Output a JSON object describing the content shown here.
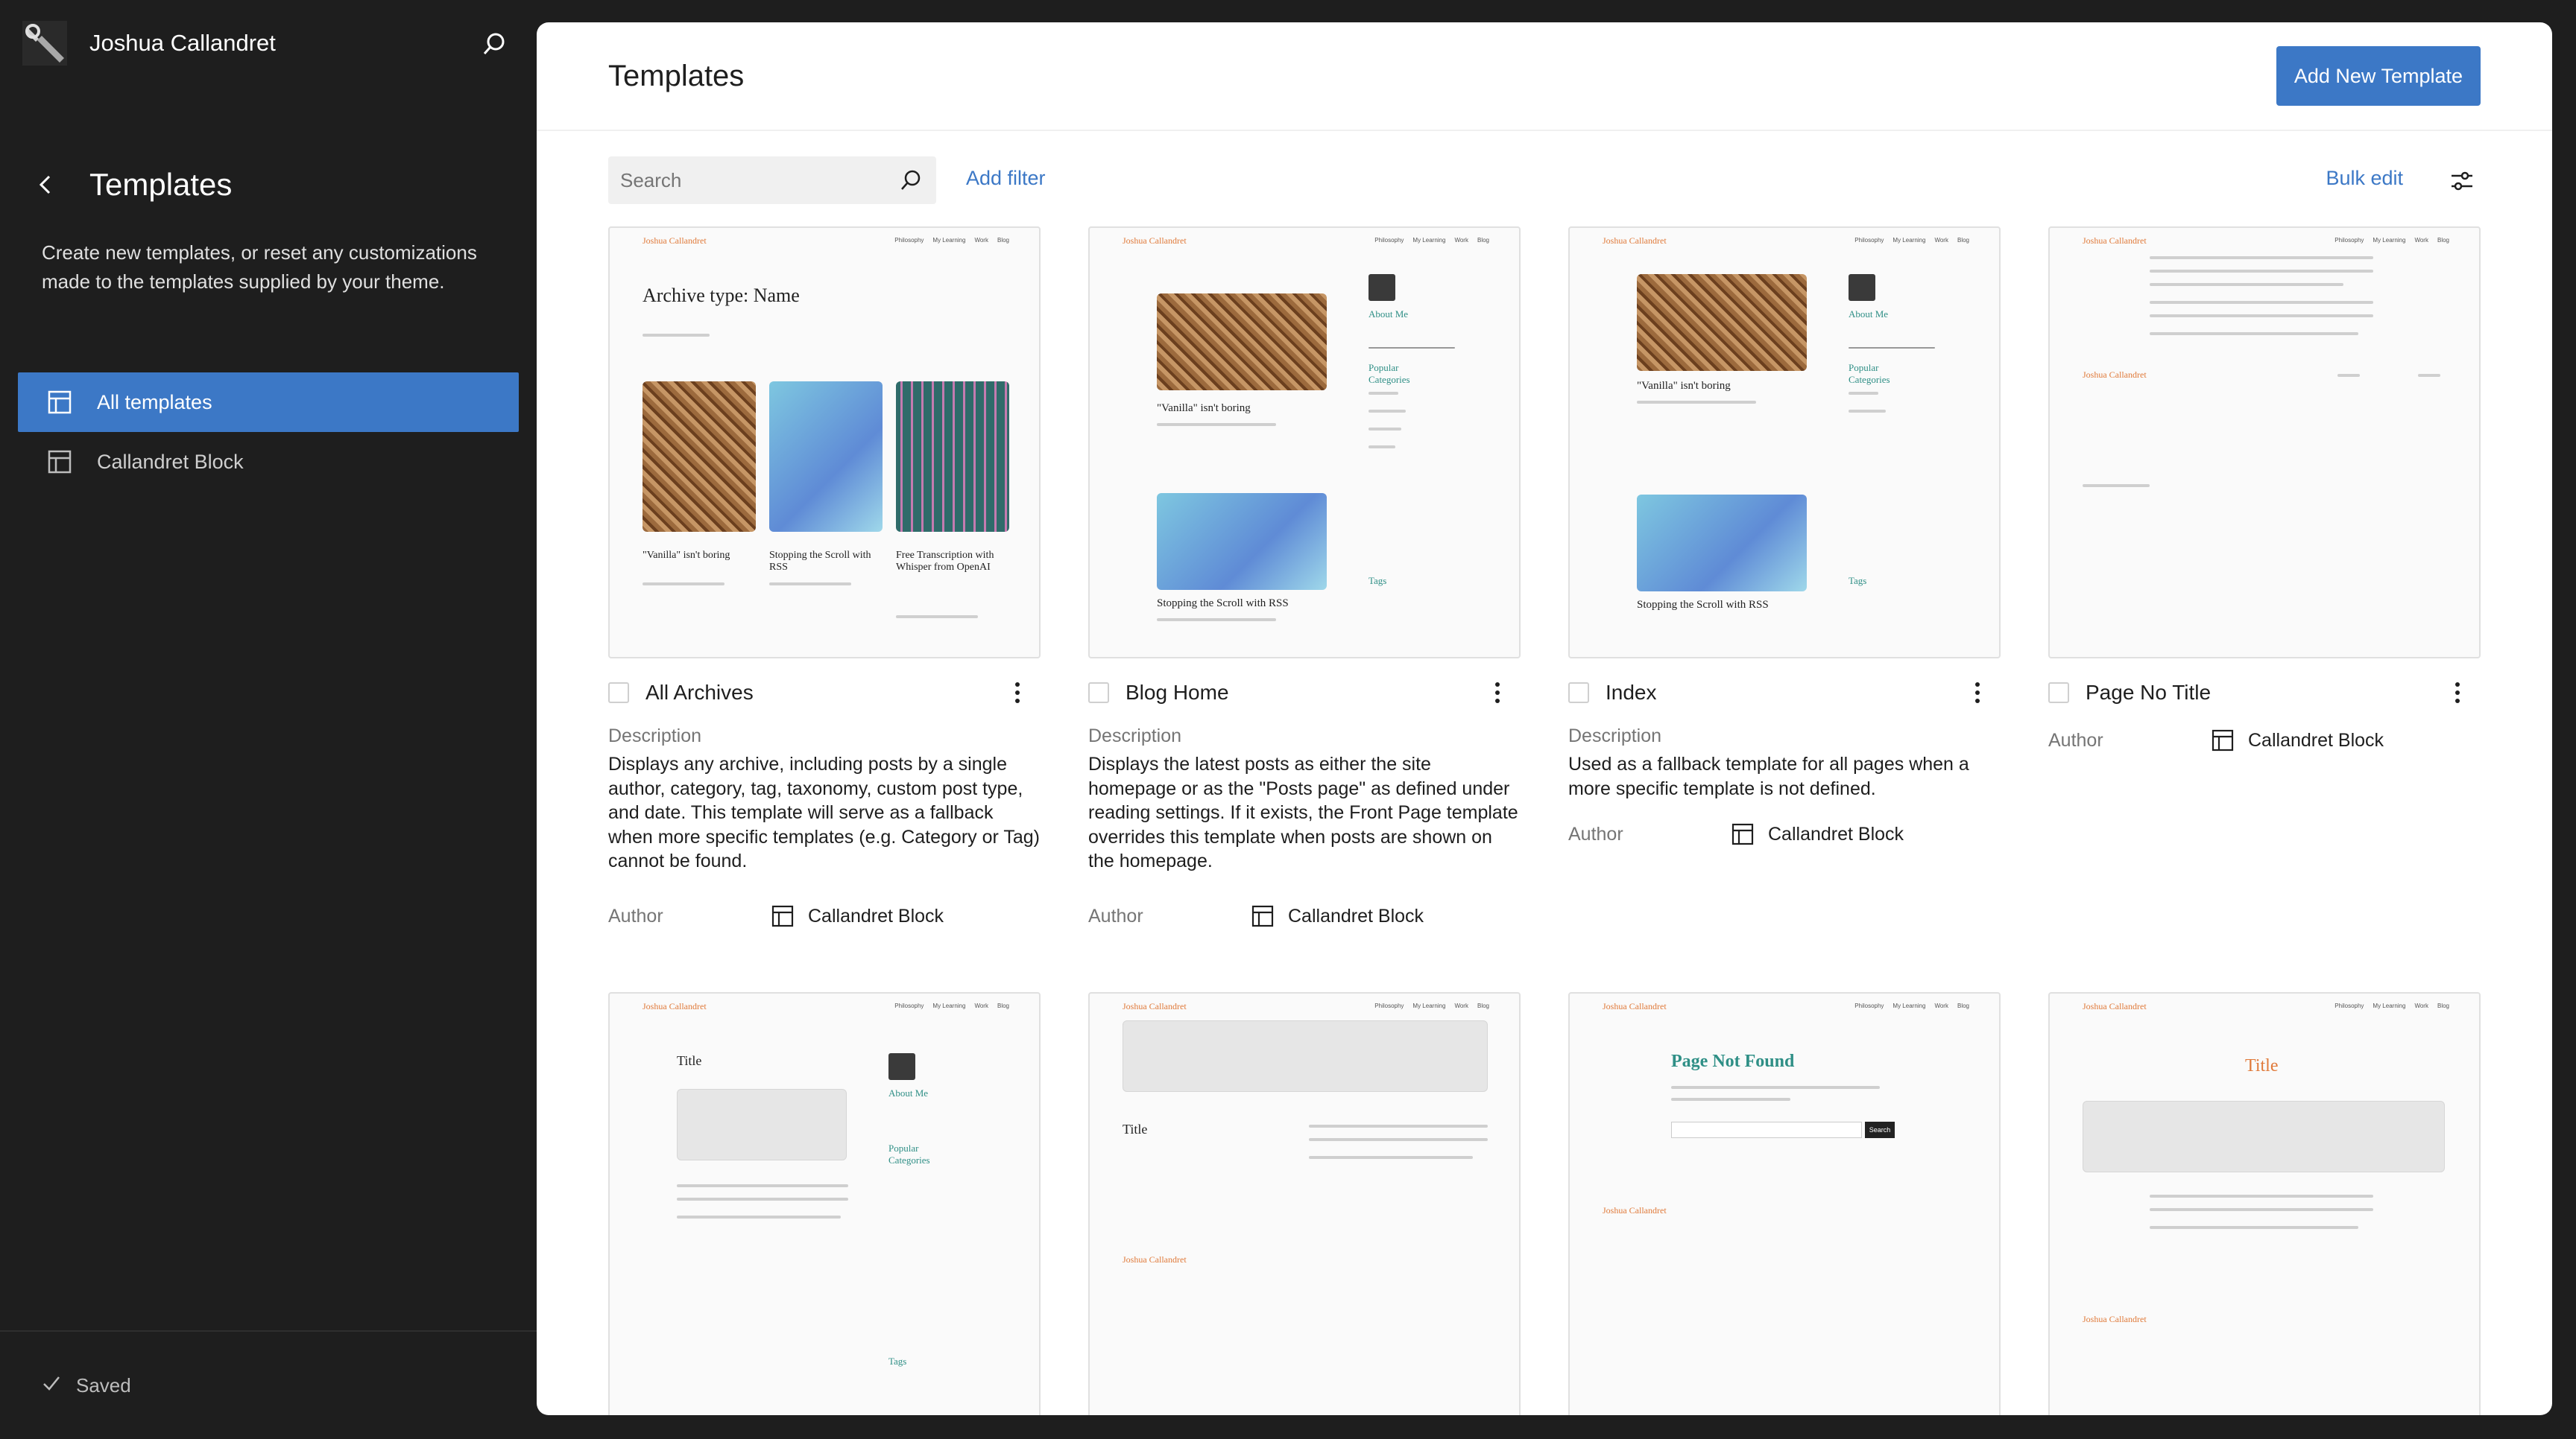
{
  "site": {
    "name": "Joshua Callandret"
  },
  "sidebar": {
    "title": "Templates",
    "description": "Create new templates, or reset any customizations made to the templates supplied by your theme.",
    "items": [
      {
        "label": "All templates",
        "active": true
      },
      {
        "label": "Callandret Block",
        "active": false
      }
    ],
    "footer_status": "Saved"
  },
  "main": {
    "title": "Templates",
    "add_button": "Add New Template",
    "search_placeholder": "Search",
    "add_filter": "Add filter",
    "bulk_edit": "Bulk edit"
  },
  "labels": {
    "description": "Description",
    "author": "Author"
  },
  "preview_text": {
    "brand": "Joshua Callandret",
    "nav": [
      "Philosophy",
      "My Learning",
      "Work",
      "Blog"
    ],
    "archive_heading": "Archive type: Name",
    "post1": "\"Vanilla\" isn't boring",
    "post2": "Stopping the Scroll with RSS",
    "post3": "Free Transcription with Whisper from OpenAI",
    "about": "About Me",
    "popular": "Popular Categories",
    "tags": "Tags",
    "title": "Title",
    "not_found": "Page Not Found",
    "search_btn": "Search"
  },
  "templates": [
    {
      "name": "All Archives",
      "description": "Displays any archive, including posts by a single author, category, tag, taxonomy, custom post type, and date. This template will serve as a fallback when more specific templates (e.g. Category or Tag) cannot be found.",
      "author": "Callandret Block"
    },
    {
      "name": "Blog Home",
      "description": "Displays the latest posts as either the site homepage or as the \"Posts page\" as defined under reading settings. If it exists, the Front Page template overrides this template when posts are shown on the homepage.",
      "author": "Callandret Block"
    },
    {
      "name": "Index",
      "description": "Used as a fallback template for all pages when a more specific template is not defined.",
      "author": "Callandret Block"
    },
    {
      "name": "Page No Title",
      "description": "",
      "author": "Callandret Block"
    }
  ],
  "colors": {
    "accent": "#3c78c6",
    "brand_orange": "#e07a3a",
    "teal": "#2f8f86"
  }
}
